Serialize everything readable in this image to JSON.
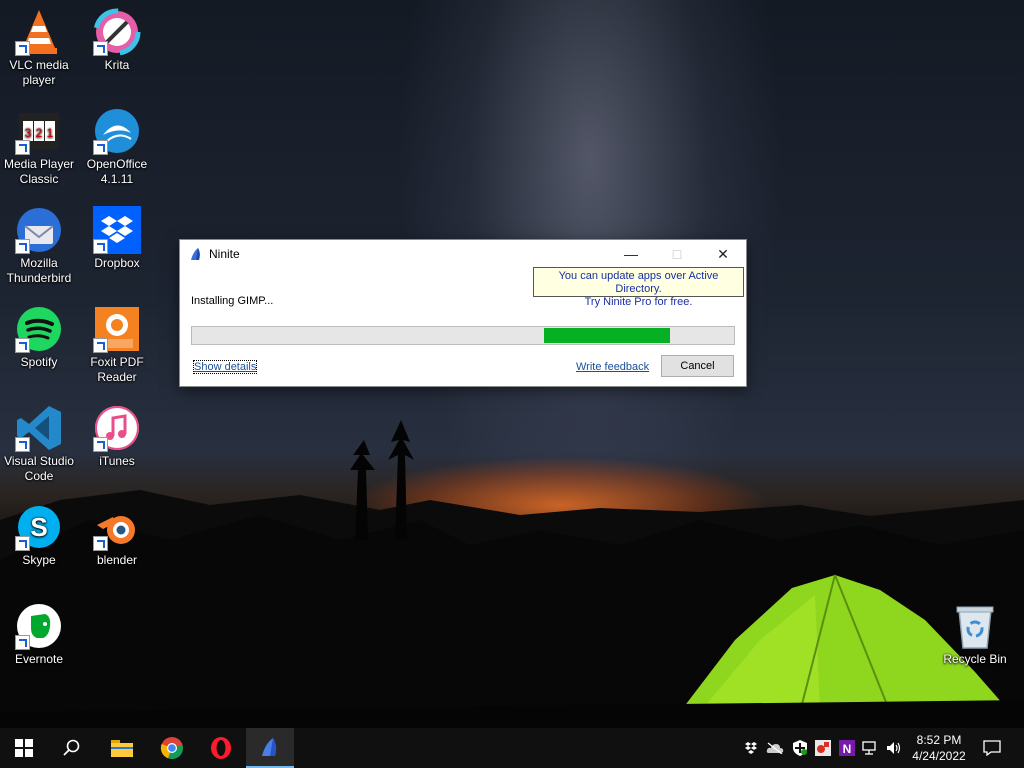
{
  "desktop": {
    "icons": [
      {
        "label": "VLC media\nplayer",
        "icon": "vlc-icon"
      },
      {
        "label": "Krita",
        "icon": "krita-icon"
      },
      {
        "label": "Media Player\nClassic",
        "icon": "media-player-classic-icon"
      },
      {
        "label": "OpenOffice\n4.1.11",
        "icon": "openoffice-icon"
      },
      {
        "label": "Mozilla\nThunderbird",
        "icon": "thunderbird-icon"
      },
      {
        "label": "Dropbox",
        "icon": "dropbox-icon"
      },
      {
        "label": "Spotify",
        "icon": "spotify-icon"
      },
      {
        "label": "Foxit PDF\nReader",
        "icon": "foxit-icon"
      },
      {
        "label": "Visual Studio\nCode",
        "icon": "vscode-icon"
      },
      {
        "label": "iTunes",
        "icon": "itunes-icon"
      },
      {
        "label": "Skype",
        "icon": "skype-icon"
      },
      {
        "label": "blender",
        "icon": "blender-icon"
      },
      {
        "label": "Evernote",
        "icon": "evernote-icon"
      },
      {
        "label": "Recycle Bin",
        "icon": "recycle-bin-icon"
      }
    ]
  },
  "ninite": {
    "title": "Ninite",
    "tooltip_line1": "You can update apps over Active Directory.",
    "tooltip_line2": "Try Ninite Pro for free.",
    "status": "Installing GIMP...",
    "progress_start": 0.649,
    "progress_end": 0.882,
    "show_details": "Show details",
    "write_feedback": "Write feedback",
    "cancel": "Cancel"
  },
  "taskbar": {
    "time": "8:52 PM",
    "date": "4/24/2022",
    "pinned": [
      "windows-start-icon",
      "search-icon",
      "file-explorer-icon",
      "chrome-icon",
      "opera-icon",
      "ninite-icon"
    ],
    "tray": [
      "dropbox-tray-icon",
      "onedrive-tray-icon",
      "defender-tray-icon",
      "app-tray-icon",
      "onenote-tray-icon",
      "network-icon",
      "volume-icon"
    ]
  },
  "colors": {
    "progress_fill": "#06b025",
    "link": "#1a4f9c",
    "tooltip_text": "#1a2fa6",
    "taskbar": "#101010"
  }
}
